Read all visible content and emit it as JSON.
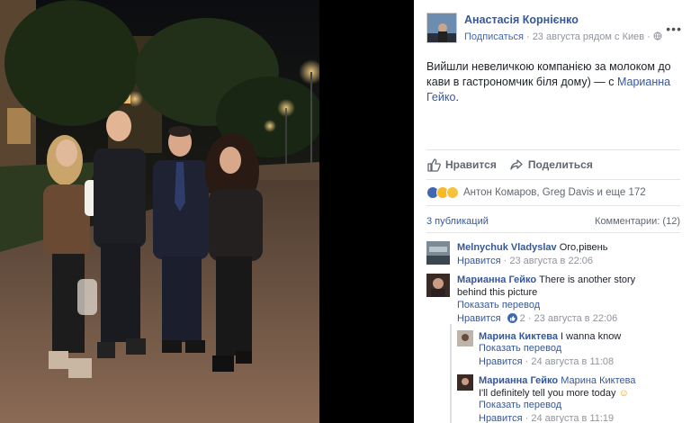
{
  "post": {
    "author": "Анастасія Корнієнко",
    "follow_label": "Подписаться",
    "meta": "· 23 августа рядом с Киев ·",
    "more_label": "•••",
    "text": "Вийшли невеличкою компанією за молоком до кави в гастрономчик біля дому) — с ",
    "tagged": "Марианна Гейко",
    "text_end": "."
  },
  "actions": {
    "like_label": "Нравится",
    "share_label": "Поделиться"
  },
  "reactions": {
    "who": "Антон Комаров, Greg Davis и еще 172",
    "colors": {
      "like": "#4267b2",
      "haha": "#f7b928",
      "wow": "#f5c33b"
    }
  },
  "stats": {
    "shares": "3 публикаций",
    "comments": "Комментарии: (12)"
  },
  "comments": [
    {
      "author": "Melnychuk Vladyslav",
      "text": " Ого,рівень",
      "like": "Нравится",
      "time": " · 23 августа в 22:06"
    },
    {
      "author": "Марианна Гейко",
      "text": " There is another story behind this picture",
      "translate": "Показать перевод",
      "like": "Нравится",
      "reaction_count": "2",
      "time": " · 23 августа в 22:06"
    },
    {
      "author": "Марина Киктева",
      "text": " I wanna know",
      "translate": "Показать перевод",
      "like": "Нравится",
      "time": " · 24 августа в 11:08"
    },
    {
      "author": "Марианна Гейко",
      "mention": "Марина Киктева",
      "text": " I'll definitely tell you more today",
      "emoji": "☺",
      "translate": "Показать перевод",
      "like": "Нравится",
      "time": " · 24 августа в 11:19"
    }
  ]
}
